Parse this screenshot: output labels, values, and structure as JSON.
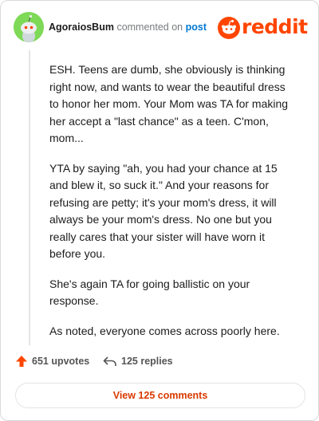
{
  "header": {
    "username": "AgoraiosBum",
    "action": "commented on",
    "post_link": "post"
  },
  "logo": {
    "wordmark": "reddit",
    "brand_color": "#ff4500"
  },
  "comment": {
    "paragraphs": [
      "ESH. Teens are dumb, she obviously is thinking right now, and wants to wear the beautiful dress to honor her mom. Your Mom was TA for making her accept a \"last chance\" as a teen. C'mon, mom...",
      "YTA by saying \"ah, you had your chance at 15 and blew it, so suck it.\" And your reasons for refusing are petty; it's your mom's dress, it will always be your mom's dress. No one but you really cares that your sister will have worn it before you.",
      "She's again TA for going ballistic on your response.",
      "As noted, everyone comes across poorly here."
    ]
  },
  "actions": {
    "upvotes_label": "651 upvotes",
    "replies_label": "125 replies",
    "upvote_icon": "upvote-arrow-icon",
    "reply_icon": "reply-arrow-icon",
    "upvote_color": "#ff4500"
  },
  "view_comments_label": "View 125 comments",
  "colors": {
    "accent": "#d93a00",
    "link": "#0079d3",
    "avatar_bg": "#7ed957"
  }
}
